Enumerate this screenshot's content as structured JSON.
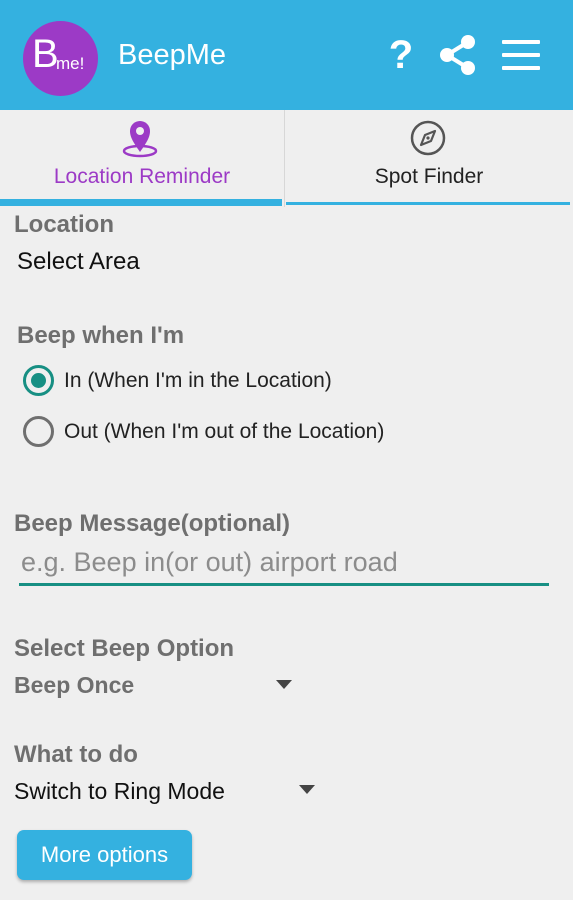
{
  "app": {
    "title": "BeepMe",
    "logo_letter": "B",
    "logo_suffix": "me!"
  },
  "toolbar": {
    "help_icon": "question-mark-icon",
    "help_glyph": "?",
    "share_icon": "share-icon",
    "menu_icon": "hamburger-menu-icon"
  },
  "tabs": [
    {
      "label": "Location Reminder",
      "icon": "location-pin-icon",
      "selected": true
    },
    {
      "label": "Spot Finder",
      "icon": "compass-icon",
      "selected": false
    }
  ],
  "form": {
    "location": {
      "label": "Location",
      "value": "Select Area"
    },
    "beep_when": {
      "label": "Beep when I'm",
      "options": [
        {
          "label": "In (When I'm in the Location)",
          "checked": true
        },
        {
          "label": "Out (When I'm out of the Location)",
          "checked": false
        }
      ]
    },
    "beep_message": {
      "label": "Beep Message(optional)",
      "placeholder": "e.g. Beep in(or out) airport road",
      "value": ""
    },
    "beep_option": {
      "label": "Select Beep Option",
      "selected": "Beep Once"
    },
    "what_to_do": {
      "label": "What to do",
      "selected": "Switch to Ring Mode"
    },
    "more_options_button": "More options"
  },
  "colors": {
    "app_bar": "#34b1e0",
    "logo_bg": "#9c3ac6",
    "selected_tab_text": "#9c3ac6",
    "accent_teal": "#178f83",
    "background": "#efefef",
    "label_gray": "#6f6f6f"
  }
}
